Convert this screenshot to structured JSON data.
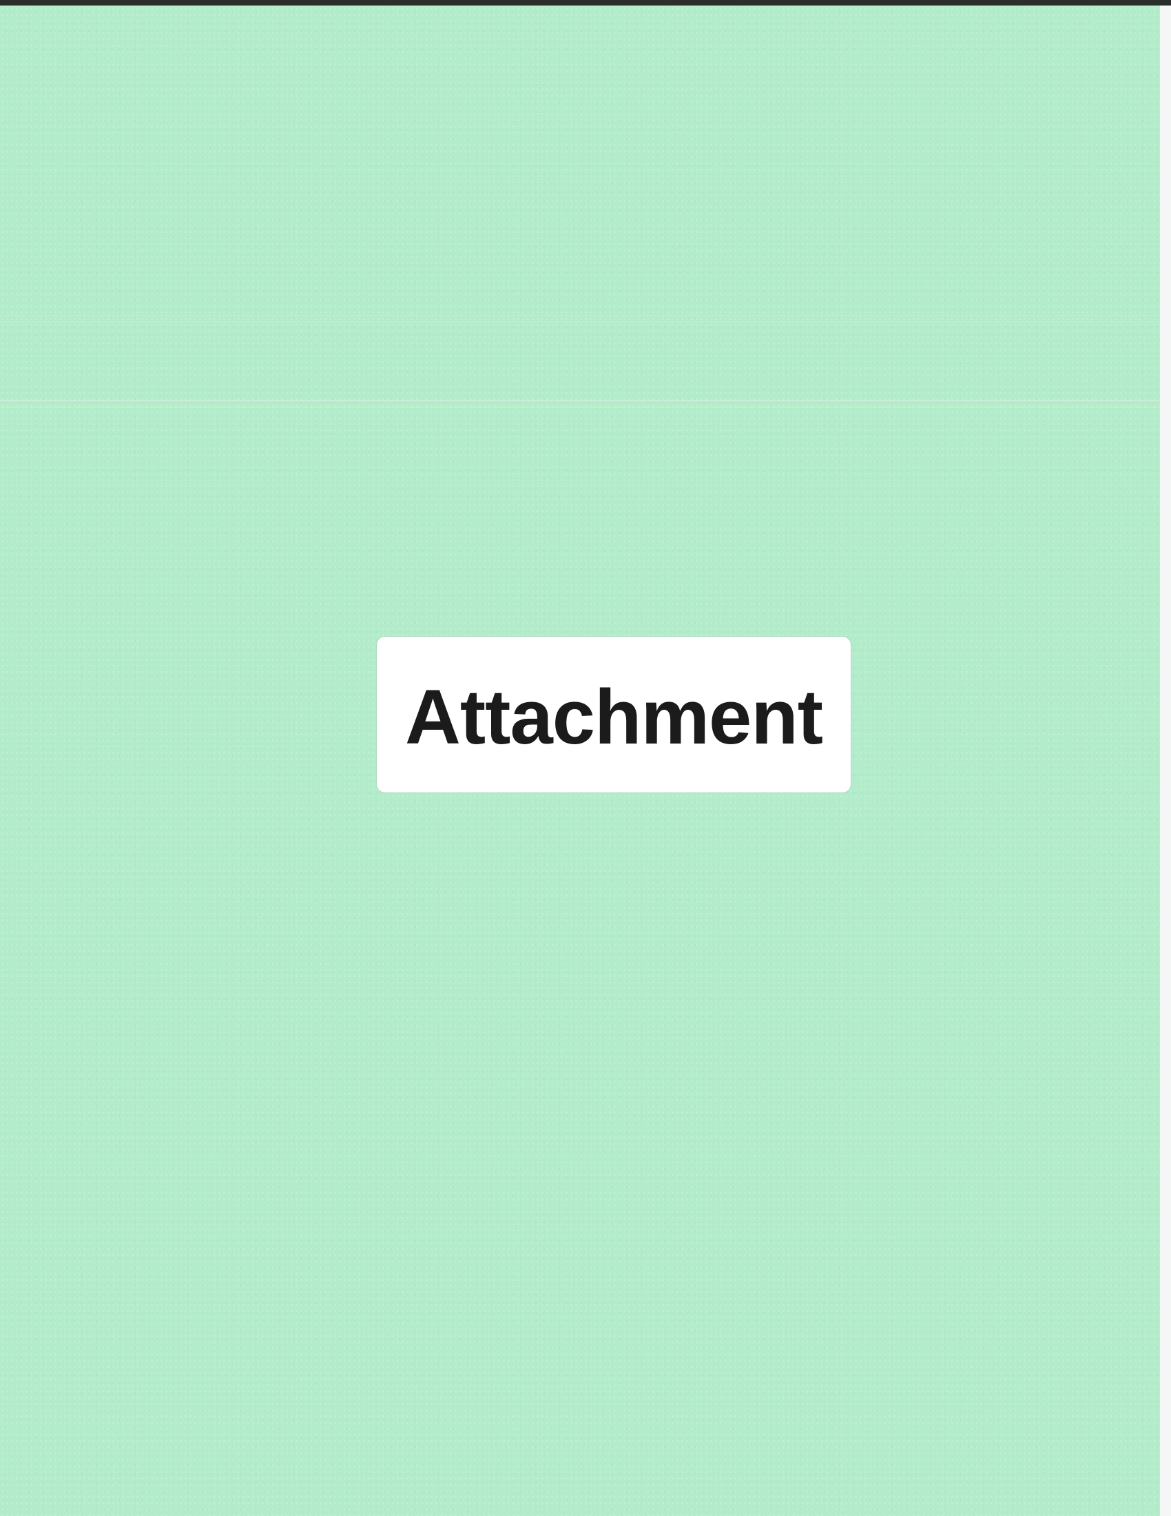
{
  "document": {
    "label_text": "Attachment",
    "colors": {
      "sheet": "#b3ecca",
      "label_background": "#ffffff",
      "label_text": "#1b1b1b"
    }
  }
}
